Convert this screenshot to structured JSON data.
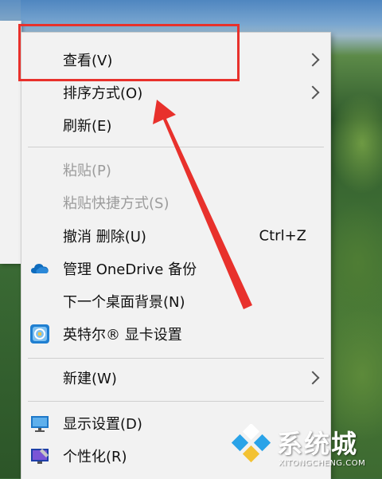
{
  "menu": {
    "items": [
      {
        "label": "查看(V)",
        "submenu": true
      },
      {
        "label": "排序方式(O)",
        "submenu": true
      },
      {
        "label": "刷新(E)"
      },
      {
        "label": "粘贴(P)",
        "disabled": true
      },
      {
        "label": "粘贴快捷方式(S)",
        "disabled": true
      },
      {
        "label": "撤消 删除(U)",
        "shortcut": "Ctrl+Z"
      },
      {
        "label": "管理 OneDrive 备份",
        "icon": "onedrive-cloud-icon"
      },
      {
        "label": "下一个桌面背景(N)"
      },
      {
        "label": "英特尔® 显卡设置",
        "icon": "intel-graphics-icon"
      },
      {
        "label": "新建(W)",
        "submenu": true
      },
      {
        "label": "显示设置(D)",
        "icon": "display-settings-icon"
      },
      {
        "label": "个性化(R)",
        "icon": "personalize-icon"
      }
    ]
  },
  "watermark": {
    "title": "系统城",
    "subtitle": "XITONGCHENG.COM"
  },
  "colors": {
    "menu_bg": "#f2f2f2",
    "annotation_red": "#e8312c",
    "disabled_text": "#9c9c9c",
    "onedrive_blue": "#0f6cbd"
  }
}
